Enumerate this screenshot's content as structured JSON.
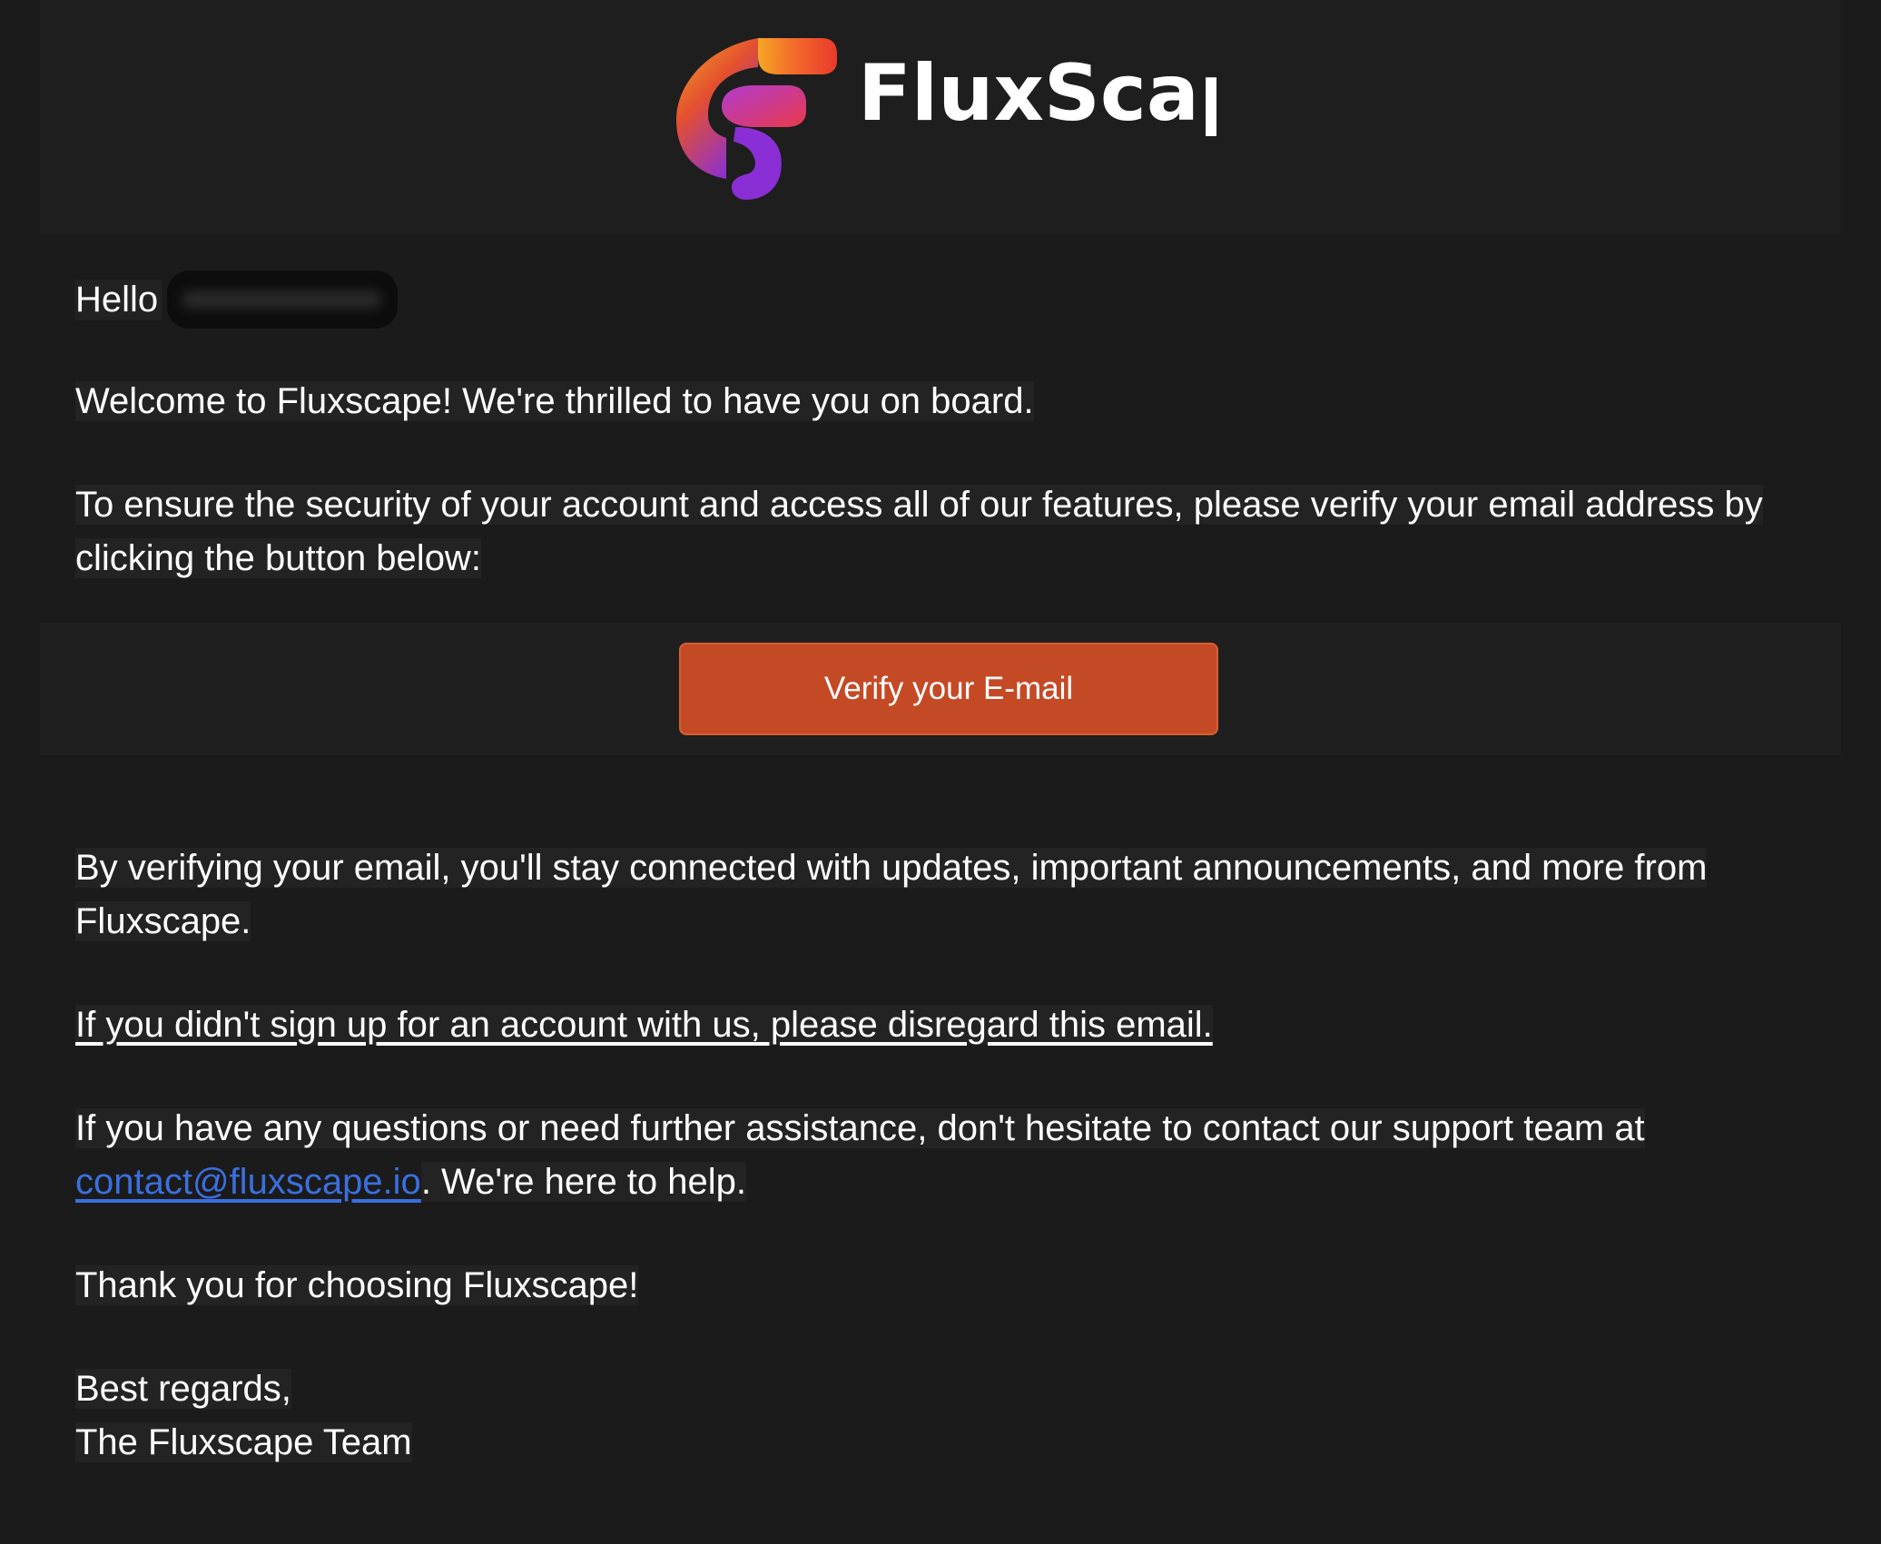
{
  "brand": {
    "name": "FluxScape",
    "logo_icon": "fluxscape-logo-icon"
  },
  "email": {
    "greeting": "Hello",
    "welcome": "Welcome to Fluxscape! We're thrilled to have you on board.",
    "security_text": "To ensure the security of your account and access all of our features, please verify your email address by clicking the button below:",
    "verify_button": "Verify your E-mail",
    "benefits": "By verifying your email, you'll stay connected with updates, important announcements, and more from Fluxscape.",
    "disregard": "If you didn't sign up for an account with us, please disregard this email.",
    "support_prefix": "If you have any questions or need further assistance, don't hesitate to contact our support team at ",
    "support_email": "contact@fluxscape.io",
    "support_suffix": ". We're here to help.",
    "thanks": "Thank you for choosing Fluxscape!",
    "signoff_1": "Best regards,",
    "signoff_2": "The Fluxscape Team"
  },
  "colors": {
    "background": "#1b1b1b",
    "button": "#c44a25",
    "link": "#3b6fe0"
  }
}
